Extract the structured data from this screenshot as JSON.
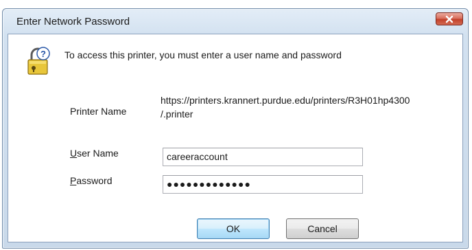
{
  "window": {
    "title": "Enter Network Password",
    "close_icon": "close-icon"
  },
  "message": {
    "icon": "lock-question-icon",
    "text": "To access this printer, you must enter a user name and password"
  },
  "printer": {
    "label": "Printer Name",
    "value_line1": "https://printers.krannert.purdue.edu/printers/R3H01hp4300",
    "value_line2": "/.printer"
  },
  "user": {
    "label_accel": "U",
    "label_rest": "ser Name",
    "value": "careeraccount"
  },
  "password": {
    "label_accel": "P",
    "label_rest": "assword",
    "value": "●●●●●●●●●●●●●"
  },
  "buttons": {
    "ok": "OK",
    "cancel": "Cancel"
  },
  "colors": {
    "title_gradient": "#d2e1f0",
    "close_button": "#c2412a",
    "ok_button_border": "#3c7fb1"
  }
}
